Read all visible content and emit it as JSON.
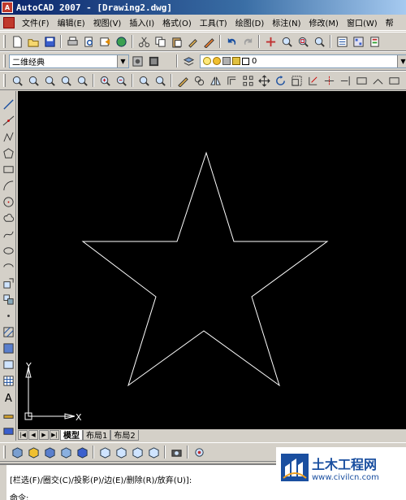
{
  "window": {
    "title": "AutoCAD 2007 - [Drawing2.dwg]"
  },
  "menu": [
    "文件(F)",
    "编辑(E)",
    "视图(V)",
    "插入(I)",
    "格式(O)",
    "工具(T)",
    "绘图(D)",
    "标注(N)",
    "修改(M)",
    "窗口(W)",
    "帮"
  ],
  "workspace": {
    "selected": "二维经典"
  },
  "layer": {
    "selected": "0"
  },
  "ucs": {
    "y_label": "Y",
    "x_label": "X"
  },
  "layout_tabs": [
    "模型",
    "布局1",
    "布局2"
  ],
  "active_tab": "模型",
  "command": {
    "line1": "[栏选(F)/圈交(C)/投影(P)/边(E)/删除(R)/放弃(U)]:",
    "prompt": "命令:"
  },
  "watermark": {
    "name": "土木工程网",
    "url": "www.civilcn.com"
  },
  "colors": {
    "canvas": "#000000",
    "geometry": "#ffffff",
    "title_start": "#0a246a"
  }
}
